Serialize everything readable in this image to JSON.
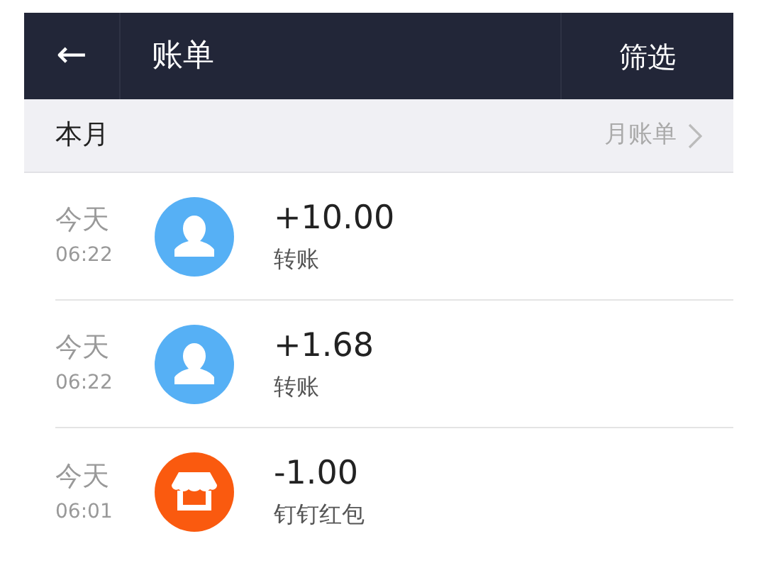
{
  "header": {
    "back": "←",
    "title": "账单",
    "action": "筛选"
  },
  "section": {
    "title": "本月",
    "link": "月账单"
  },
  "transactions": [
    {
      "day": "今天",
      "time": "06:22",
      "kind": "person",
      "amount": "+10.00",
      "type": "转账"
    },
    {
      "day": "今天",
      "time": "06:22",
      "kind": "person",
      "amount": "+1.68",
      "type": "转账"
    },
    {
      "day": "今天",
      "time": "06:01",
      "kind": "shop",
      "amount": "-1.00",
      "type": "钉钉红包"
    }
  ]
}
